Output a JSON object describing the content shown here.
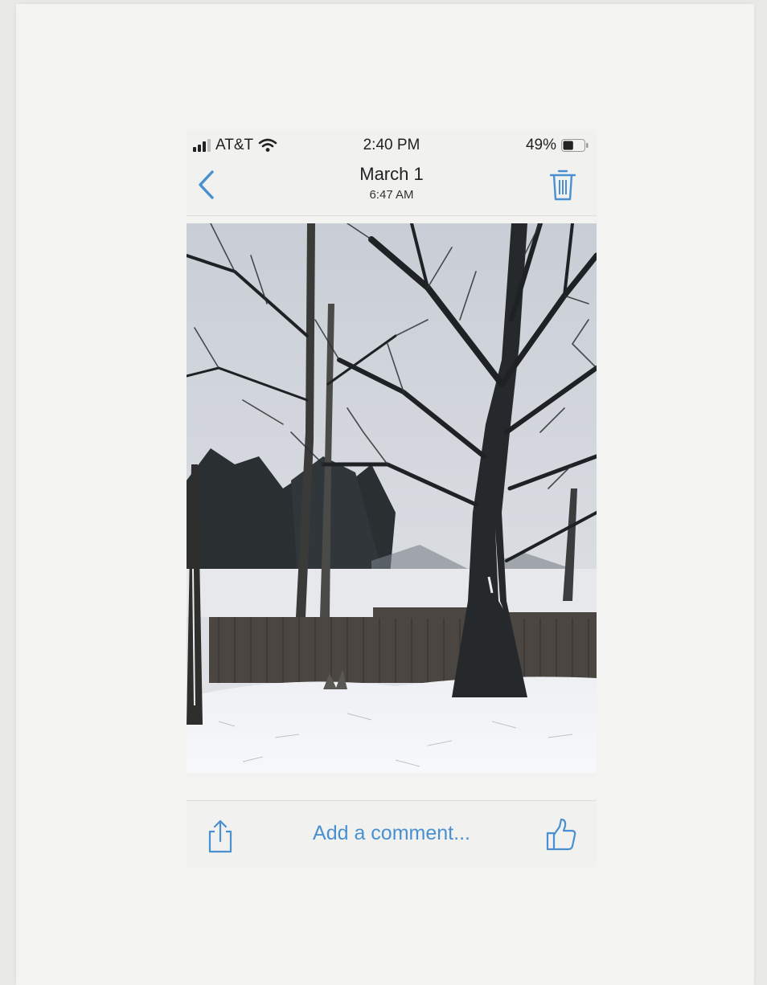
{
  "status_bar": {
    "carrier": "AT&T",
    "time": "2:40 PM",
    "battery_percent": "49%",
    "battery_level": 0.49,
    "icons": [
      "signal-bars-icon",
      "wifi-icon",
      "battery-icon"
    ]
  },
  "nav": {
    "title": "March 1",
    "subtitle": "6:47 AM",
    "back_icon": "chevron-left-icon",
    "trash_icon": "trash-icon"
  },
  "photo": {
    "subject": "snowy backyard with bare trees and wooden fence"
  },
  "toolbar": {
    "share_icon": "share-icon",
    "comment_placeholder": "Add a comment...",
    "like_icon": "thumbs-up-icon"
  },
  "colors": {
    "accent": "#4a90d0",
    "bar_background": "#f1f1ef",
    "paper": "#f3f3f1"
  }
}
